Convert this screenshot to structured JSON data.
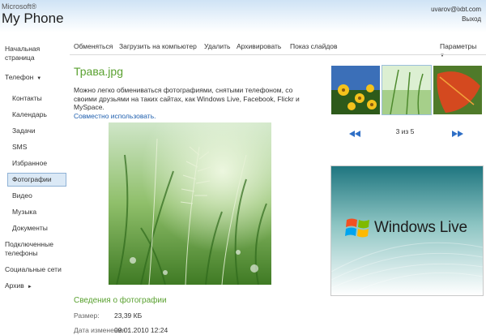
{
  "header": {
    "brand_top": "Microsoft®",
    "brand_main": "My Phone",
    "user_email": "uvarov@ixbt.com",
    "logout": "Выход"
  },
  "sidebar": {
    "home": "Начальная страница",
    "phone": "Телефон",
    "items": [
      "Контакты",
      "Календарь",
      "Задачи",
      "SMS",
      "Избранное",
      "Фотографии",
      "Видео",
      "Музыка",
      "Документы"
    ],
    "connected": "Подключенные телефоны",
    "social": "Социальные сети",
    "archive": "Архив"
  },
  "toolbar": {
    "share": "Обменяться",
    "download": "Загрузить на компьютер",
    "delete": "Удалить",
    "archive": "Архивировать",
    "slideshow": "Показ слайдов",
    "options": "Параметры"
  },
  "photo": {
    "title": "Трава.jpg",
    "description": "Можно легко обмениваться фотографиями, снятыми телефоном, со своими друзьями на таких сайтах, как Windows Live, Facebook, Flickr и MySpace.",
    "share_link": "Совместно использовать."
  },
  "details": {
    "heading": "Сведения о фотографии",
    "size_label": "Размер:",
    "size_value": "23,39 КБ",
    "date_label": "Дата изменения :",
    "date_value": "09.01.2010 12:24"
  },
  "gallery": {
    "counter": "3 из 5"
  },
  "ad": {
    "text": "Windows Live"
  },
  "colors": {
    "accent_green": "#5aa130",
    "link_blue": "#1f5fae",
    "selected_bg": "#dbe9f6"
  }
}
